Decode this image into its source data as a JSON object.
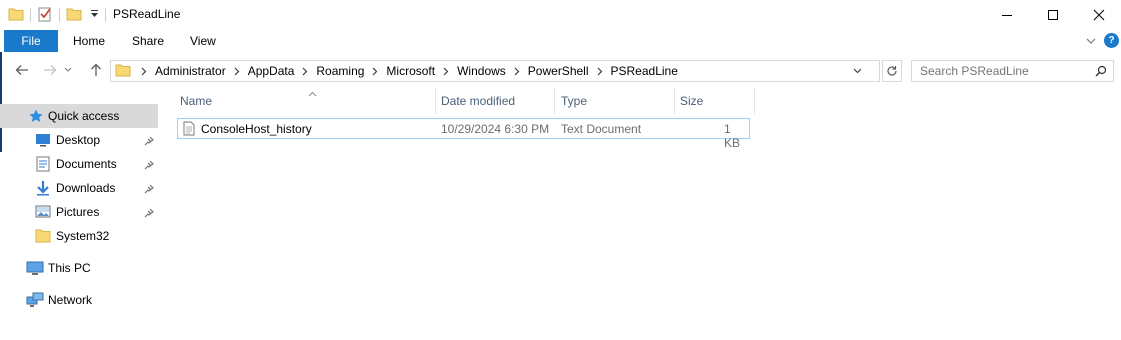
{
  "window": {
    "title": "PSReadLine",
    "controls": [
      "minimize",
      "maximize",
      "close"
    ]
  },
  "ribbon": {
    "tabs": [
      "File",
      "Home",
      "Share",
      "View"
    ],
    "help_label": "?"
  },
  "address": {
    "crumbs": [
      "Administrator",
      "AppData",
      "Roaming",
      "Microsoft",
      "Windows",
      "PowerShell",
      "PSReadLine"
    ]
  },
  "search": {
    "placeholder": "Search PSReadLine"
  },
  "nav": {
    "quick_access": "Quick access",
    "items": [
      {
        "label": "Desktop",
        "icon": "desktop-icon",
        "pinned": true
      },
      {
        "label": "Documents",
        "icon": "documents-icon",
        "pinned": true
      },
      {
        "label": "Downloads",
        "icon": "downloads-icon",
        "pinned": true
      },
      {
        "label": "Pictures",
        "icon": "pictures-icon",
        "pinned": true
      },
      {
        "label": "System32",
        "icon": "folder-icon",
        "pinned": false
      }
    ],
    "this_pc": "This PC",
    "network": "Network"
  },
  "list": {
    "columns": [
      "Name",
      "Date modified",
      "Type",
      "Size"
    ],
    "rows": [
      {
        "name": "ConsoleHost_history",
        "date": "10/29/2024 6:30 PM",
        "type": "Text Document",
        "size": "1 KB"
      }
    ]
  },
  "colors": {
    "accent": "#1979ca",
    "selection": "#d9d9d9",
    "row_border": "#99d1ff",
    "header_text": "#4c607a",
    "folder": "#f8d775"
  }
}
